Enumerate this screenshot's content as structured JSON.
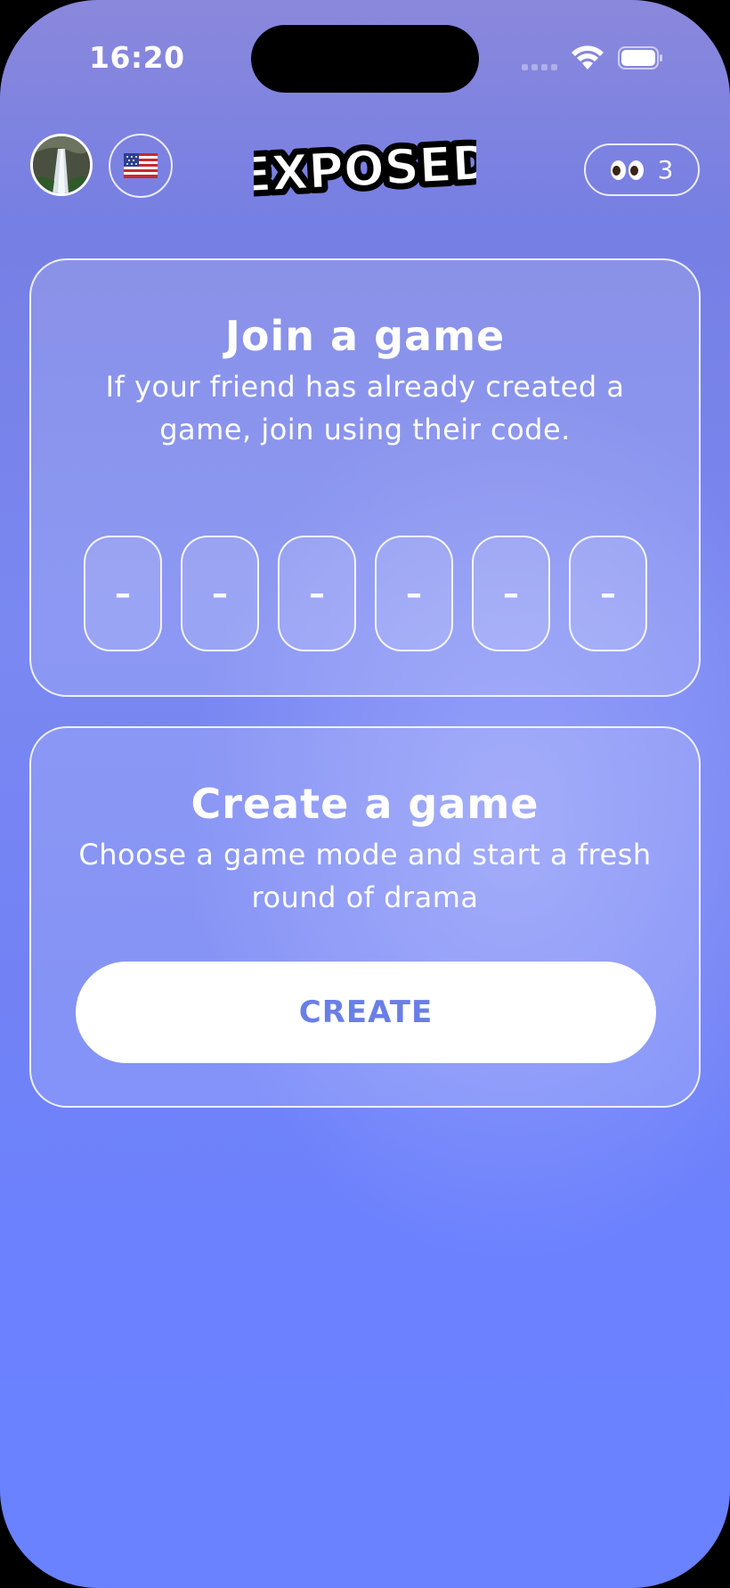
{
  "status_bar": {
    "time": "16:20"
  },
  "header": {
    "avatar_icon": "profile-avatar-waterfall",
    "flag_icon": "us-flag-icon",
    "logo_text": "EXPOSED",
    "coins": {
      "icon": "eyes-emoji-icon",
      "count": "3"
    }
  },
  "join": {
    "title": "Join a game",
    "description": "If your friend has already created a game, join using their code.",
    "code_slots": [
      "–",
      "–",
      "–",
      "–",
      "–",
      "–"
    ]
  },
  "create": {
    "title": "Create a game",
    "description": "Choose a game mode and start a fresh round of drama",
    "button_label": "CREATE"
  },
  "colors": {
    "accent": "#6a7ee8",
    "background_top": "#8a88dc",
    "background_bottom": "#6a82ff"
  }
}
